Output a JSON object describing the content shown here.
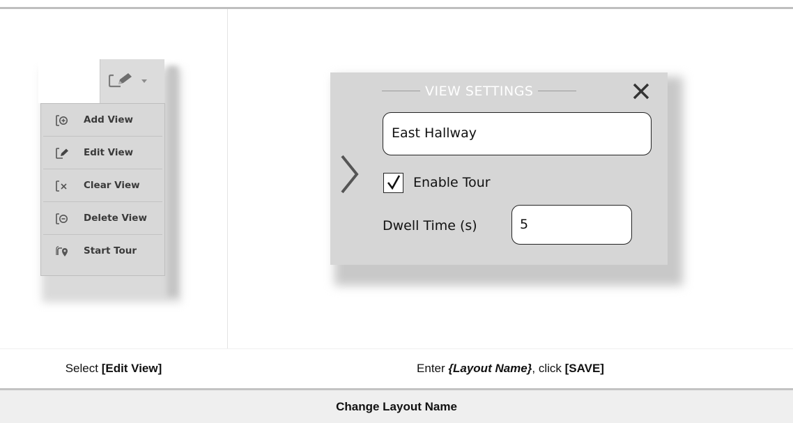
{
  "menu": {
    "items": [
      {
        "label": "Add View",
        "icon": "add-view-icon"
      },
      {
        "label": "Edit View",
        "icon": "edit-view-icon"
      },
      {
        "label": "Clear View",
        "icon": "clear-view-icon"
      },
      {
        "label": "Delete View",
        "icon": "delete-view-icon"
      },
      {
        "label": "Start Tour",
        "icon": "start-tour-icon"
      }
    ]
  },
  "view_settings": {
    "title": "VIEW SETTINGS",
    "name_value": "East Hallway",
    "enable_tour_label": "Enable Tour",
    "enable_tour_checked": true,
    "dwell_label": "Dwell Time (s)",
    "dwell_value": "5"
  },
  "captions": {
    "left_prefix": "Select ",
    "left_bold": "[Edit View]",
    "right_prefix": "Enter ",
    "right_bold_italic": "{Layout Name}",
    "right_middle": ", click ",
    "right_bold": "[SAVE]"
  },
  "footer": {
    "title": "Change Layout Name"
  },
  "colors": {
    "menu_bg": "#d8d8d8",
    "panel_bg": "#d6d6d6",
    "footer_bg": "#efefef"
  }
}
